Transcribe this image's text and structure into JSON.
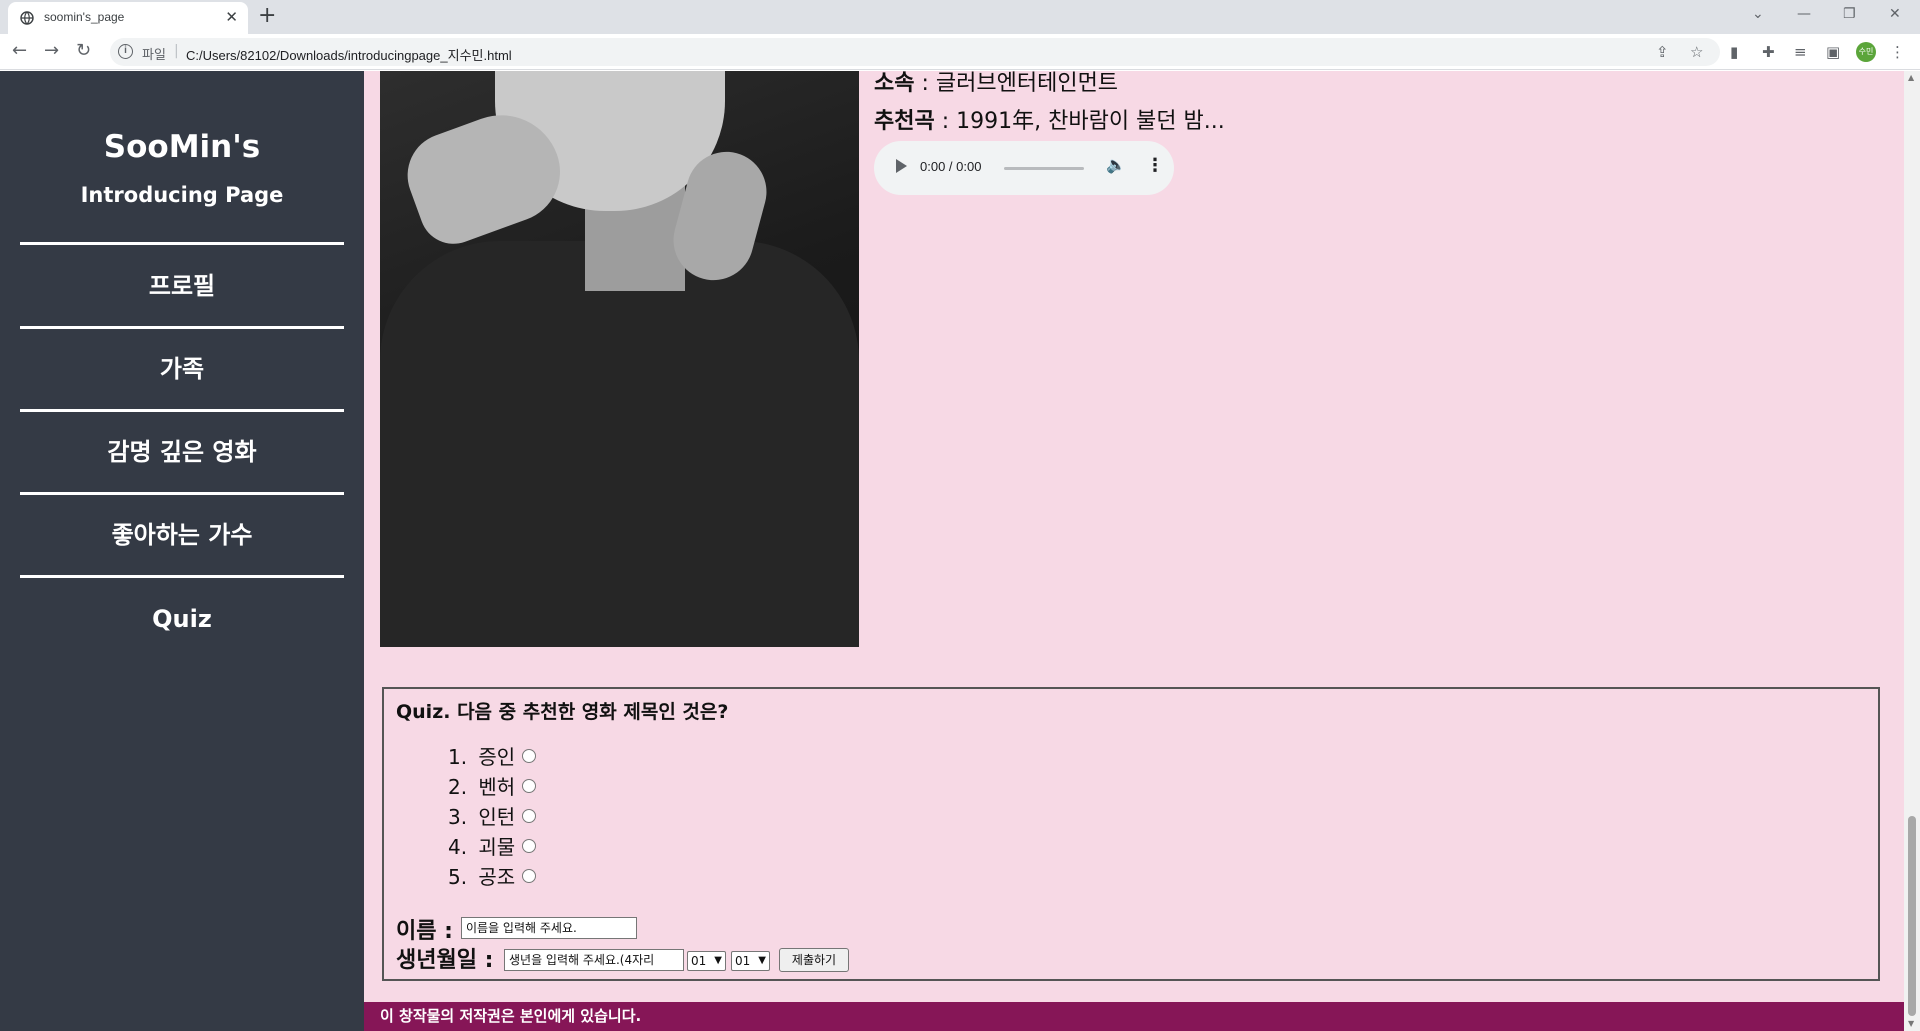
{
  "browser": {
    "tab_title": "soomin's_page",
    "tab_close": "✕",
    "new_tab": "+",
    "scheme_label": "파일",
    "url": "C:/Users/82102/Downloads/introducingpage_지수민.html",
    "profile_initial": "수민"
  },
  "sidebar": {
    "title": "SooMin's",
    "subtitle": "Introducing Page",
    "items": [
      {
        "label": "프로필"
      },
      {
        "label": "가족"
      },
      {
        "label": "감명 깊은 영화"
      },
      {
        "label": "좋아하는 가수"
      },
      {
        "label": "Quiz"
      }
    ]
  },
  "singer": {
    "agency_label": "소속",
    "agency_value": " : 글러브엔터테인먼트",
    "song_label": "추천곡",
    "song_value": " : 1991年, 찬바람이 불던 밤...",
    "audio_time": "0:00 / 0:00"
  },
  "quiz": {
    "question": "Quiz. 다음 중 추천한 영화 제목인 것은?",
    "options": [
      {
        "num": "1.",
        "label": "증인"
      },
      {
        "num": "2.",
        "label": "벤허"
      },
      {
        "num": "3.",
        "label": "인턴"
      },
      {
        "num": "4.",
        "label": "괴물"
      },
      {
        "num": "5.",
        "label": "공조"
      }
    ],
    "name_label": "이름 :",
    "name_placeholder": "이름을 입력해 주세요.",
    "birth_label": "생년월일 :",
    "birth_placeholder": "생년을 입력해 주세요.(4자리",
    "month_value": "01",
    "day_value": "01",
    "submit_label": "제출하기"
  },
  "footer": {
    "text": "이 창작물의 저작권은 본인에게 있습니다."
  },
  "colors": {
    "page_bg": "#f7d9e5",
    "sidebar_bg": "#343a45",
    "footer_bg": "#861657"
  }
}
